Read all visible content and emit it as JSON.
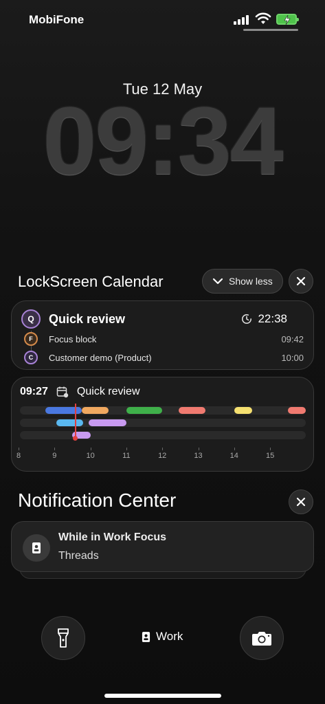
{
  "status_bar": {
    "carrier": "MobiFone"
  },
  "lockscreen": {
    "date": "Tue 12 May",
    "time": "09:34"
  },
  "calendar_widget": {
    "title": "LockScreen Calendar",
    "show_less_label": "Show less",
    "next_event": {
      "badge": "Q",
      "title": "Quick review",
      "time": "22:38",
      "badge_color": "#a882d6"
    },
    "upcoming": [
      {
        "badge": "F",
        "title": "Focus block",
        "time": "09:42",
        "badge_color": "#d58b4b"
      },
      {
        "badge": "C",
        "title": "Customer demo (Product)",
        "time": "10:00",
        "badge_color": "#a882d6"
      }
    ]
  },
  "timeline_widget": {
    "current_time": "09:27",
    "current_event": "Quick review",
    "hours": [
      "8",
      "9",
      "10",
      "11",
      "12",
      "13",
      "14",
      "15"
    ],
    "now_hour": 9.58,
    "lanes": [
      [
        {
          "start": 8.75,
          "end": 9.75,
          "color": "#4a78e0"
        },
        {
          "start": 9.75,
          "end": 10.5,
          "color": "#f0a860"
        },
        {
          "start": 11.0,
          "end": 12.0,
          "color": "#3fb04a"
        },
        {
          "start": 12.45,
          "end": 13.2,
          "color": "#f07a70"
        },
        {
          "start": 14.0,
          "end": 14.5,
          "color": "#f5e070"
        },
        {
          "start": 15.5,
          "end": 16.0,
          "color": "#f07a70"
        }
      ],
      [
        {
          "start": 9.05,
          "end": 9.8,
          "color": "#5ab8f0"
        },
        {
          "start": 9.95,
          "end": 11.0,
          "color": "#c89af0"
        }
      ],
      [
        {
          "start": 9.5,
          "end": 10.0,
          "color": "#c89af0"
        }
      ]
    ]
  },
  "notification_center": {
    "title": "Notification Center",
    "notification": {
      "title": "While in Work Focus",
      "body": "Threads"
    }
  },
  "bottom": {
    "focus_label": "Work"
  }
}
